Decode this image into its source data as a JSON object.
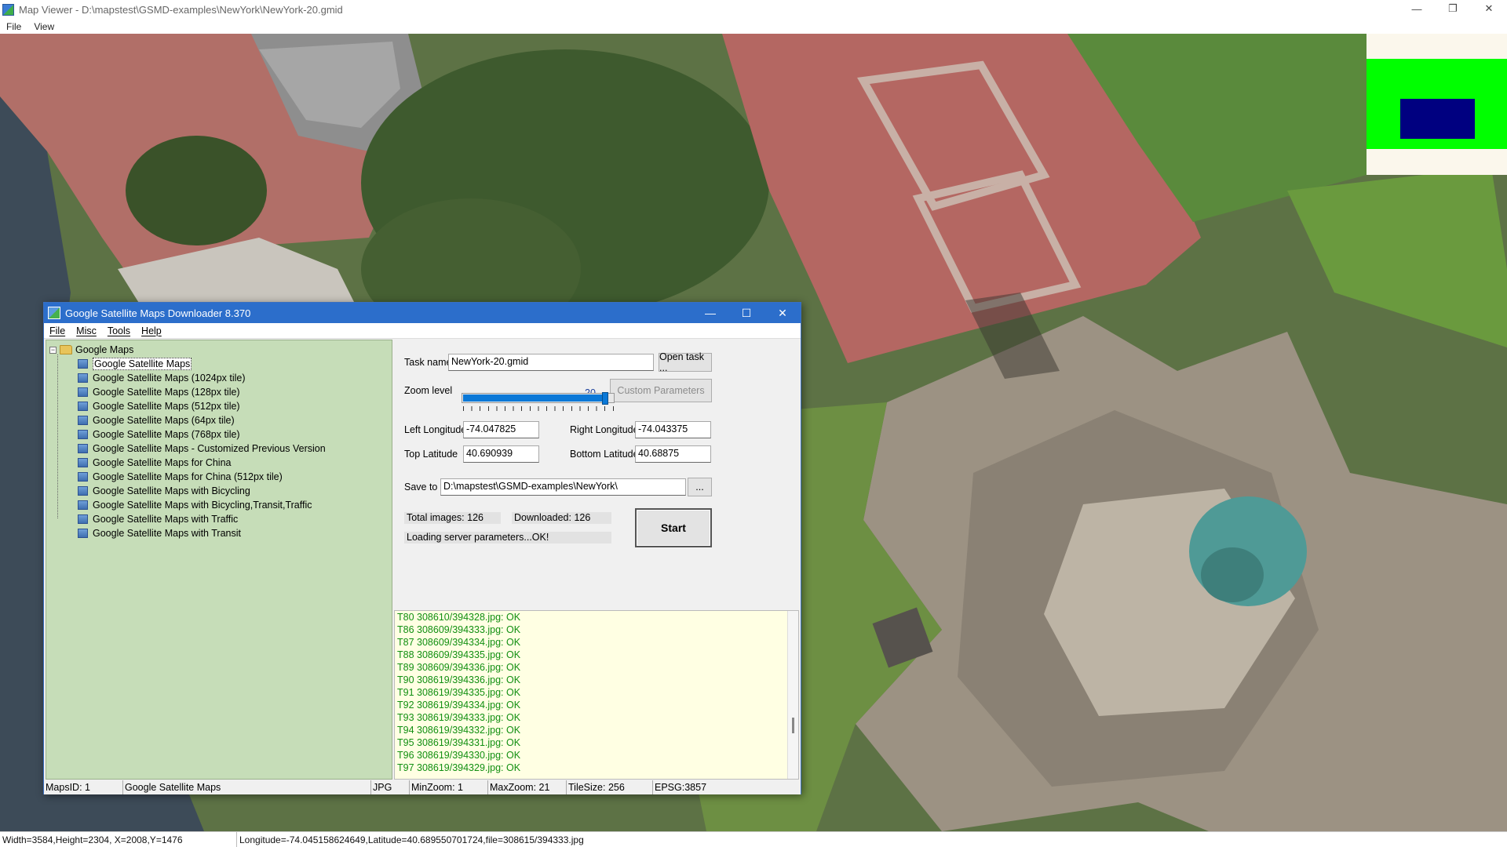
{
  "window": {
    "title": "Map Viewer - D:\\mapstest\\GSMD-examples\\NewYork\\NewYork-20.gmid",
    "controls": [
      "—",
      "❐",
      "✕"
    ],
    "menu": [
      "File",
      "View"
    ]
  },
  "overview_colors": {
    "background": "#fbf7ec",
    "area": "#00ff00",
    "view": "#000080"
  },
  "dialog": {
    "title": "Google Satellite Maps Downloader 8.370",
    "controls": [
      "—",
      "☐",
      "✕"
    ],
    "menu": [
      "File",
      "Misc",
      "Tools",
      "Help"
    ],
    "tree": {
      "root": "Google Maps",
      "items": [
        "Google Satellite Maps",
        "Google Satellite Maps (1024px tile)",
        "Google Satellite Maps (128px tile)",
        "Google Satellite Maps (512px tile)",
        "Google Satellite Maps (64px tile)",
        "Google Satellite Maps (768px tile)",
        "Google Satellite Maps - Customized Previous Version",
        "Google Satellite Maps for China",
        "Google Satellite Maps for China (512px tile)",
        "Google Satellite Maps with Bicycling",
        "Google Satellite Maps with Bicycling,Transit,Traffic",
        "Google Satellite Maps with Traffic",
        "Google Satellite Maps with Transit"
      ]
    },
    "task_label": "Task name",
    "task_value": "NewYork-20.gmid",
    "open_task": "Open task ...",
    "zoom_label": "Zoom level",
    "zoom_value": "20",
    "zoom_fraction": 0.95,
    "custom_params": "Custom Parameters",
    "left_lon_label": "Left Longitude",
    "left_lon": "-74.047825",
    "right_lon_label": "Right Longitude",
    "right_lon": "-74.043375",
    "top_lat_label": "Top Latitude",
    "top_lat": "40.690939",
    "bottom_lat_label": "Bottom Latitude",
    "bottom_lat": "40.68875",
    "save_label": "Save to",
    "save_path": "D:\\mapstest\\GSMD-examples\\NewYork\\",
    "browse": "...",
    "total_images": "Total images: 126",
    "downloaded": "Downloaded: 126",
    "loading": "Loading server parameters...OK!",
    "start": "Start",
    "log": [
      "T80 308610/394328.jpg: OK",
      "T86 308609/394333.jpg: OK",
      "T87 308609/394334.jpg: OK",
      "T88 308609/394335.jpg: OK",
      "T89 308609/394336.jpg: OK",
      "T90 308619/394336.jpg: OK",
      "T91 308619/394335.jpg: OK",
      "T92 308619/394334.jpg: OK",
      "T93 308619/394333.jpg: OK",
      "T94 308619/394332.jpg: OK",
      "T95 308619/394331.jpg: OK",
      "T96 308619/394330.jpg: OK",
      "T97 308619/394329.jpg: OK"
    ],
    "status": {
      "maps_id": "MapsID: 1",
      "map_name": "Google Satellite Maps",
      "format": "JPG",
      "min_zoom": "MinZoom: 1",
      "max_zoom": "MaxZoom: 21",
      "tile_size": "TileSize: 256",
      "epsg": "EPSG:3857"
    }
  },
  "statusbar": {
    "dims": "Width=3584,Height=2304, X=2008,Y=1476",
    "coords": "Longitude=-74.045158624649,Latitude=40.689550701724,file=308615/394333.jpg"
  }
}
